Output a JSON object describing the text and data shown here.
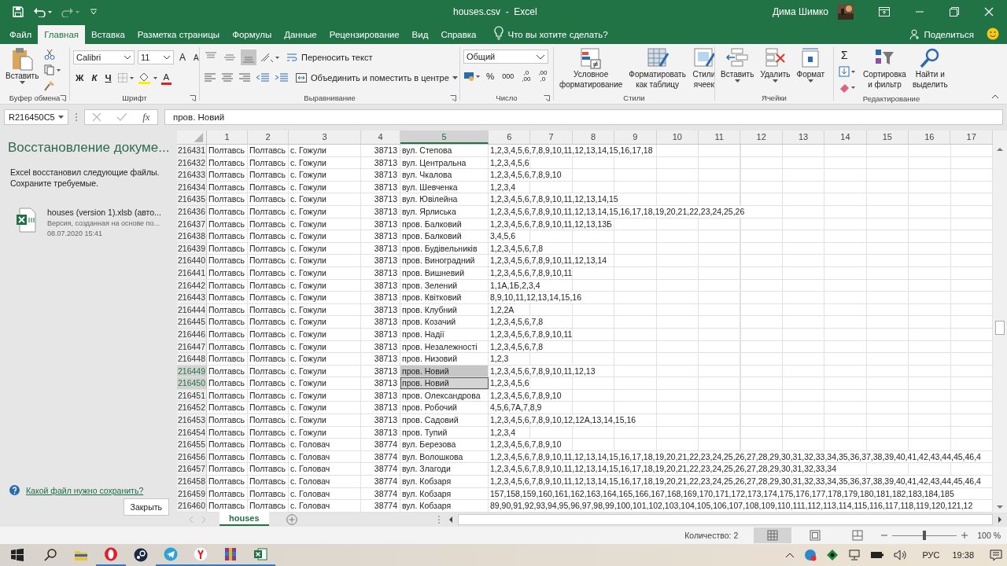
{
  "title_bar": {
    "title": "houses.csv  -  Excel",
    "user": "Дима Шимко"
  },
  "menu_tabs": [
    {
      "label": "Файл",
      "selected": false
    },
    {
      "label": "Главная",
      "selected": true
    },
    {
      "label": "Вставка",
      "selected": false
    },
    {
      "label": "Разметка страницы",
      "selected": false
    },
    {
      "label": "Формулы",
      "selected": false
    },
    {
      "label": "Данные",
      "selected": false
    },
    {
      "label": "Рецензирование",
      "selected": false
    },
    {
      "label": "Вид",
      "selected": false
    },
    {
      "label": "Справка",
      "selected": false
    }
  ],
  "tell_me": "Что вы хотите сделать?",
  "share": "Поделиться",
  "ribbon": {
    "clipboard": {
      "label": "Буфер обмена",
      "paste": "Вставить"
    },
    "font": {
      "label": "Шрифт",
      "name": "Calibri",
      "size": "11",
      "grow": "A",
      "shrink": "A",
      "bold": "Ж",
      "italic": "К",
      "underline": "Ч",
      "color_letter": "A"
    },
    "alignment": {
      "label": "Выравнивание",
      "vertical": [
        {
          "kind": "top",
          "selected": false
        },
        {
          "kind": "middle",
          "selected": false
        },
        {
          "kind": "bottom",
          "selected": true
        }
      ],
      "wrap": "Переносить текст",
      "merge": "Объединить и поместить в центре"
    },
    "number": {
      "label": "Число",
      "format": "Общий",
      "percent": "%",
      "thousands": "000",
      "decimals": [
        {
          "top": ",0",
          "bottom": ",00"
        },
        {
          "top": ",00",
          "bottom": ",0"
        }
      ]
    },
    "styles": {
      "label": "Стили",
      "buttons": [
        {
          "kind": "conditional",
          "lines": [
            "Условное",
            "форматирование"
          ]
        },
        {
          "kind": "table",
          "lines": [
            "Форматировать",
            "как таблицу"
          ]
        },
        {
          "kind": "cell",
          "lines": [
            "Стили",
            "ячеек"
          ]
        }
      ]
    },
    "cells": {
      "label": "Ячейки",
      "buttons": [
        {
          "kind": "insert",
          "label": "Вставить"
        },
        {
          "kind": "delete",
          "label": "Удалить"
        },
        {
          "kind": "format",
          "label": "Формат"
        }
      ]
    },
    "editing": {
      "label": "Редактирование",
      "sum": "Σ",
      "buttons": [
        {
          "kind": "sort",
          "lines": [
            "Сортировка",
            "и фильтр"
          ]
        },
        {
          "kind": "find",
          "lines": [
            "Найти и",
            "выделить"
          ]
        }
      ]
    }
  },
  "formula_bar": {
    "name_box": "R216450C5",
    "fx": "fx",
    "value": "пров. Новий"
  },
  "recovery": {
    "title": "Восстановление докуме...",
    "message": "Excel восстановил следующие файлы. Сохраните требуемые.",
    "file": {
      "name": "houses (version 1).xlsb  (авто...",
      "description": "Версия, созданная на основе по...",
      "date": "08.07.2020 15:41"
    },
    "help_link": "Какой файл нужно сохранить?",
    "close": "Закрыть"
  },
  "grid": {
    "columns": [
      {
        "label": "1",
        "selected": false
      },
      {
        "label": "2",
        "selected": false
      },
      {
        "label": "3",
        "selected": false
      },
      {
        "label": "4",
        "selected": false
      },
      {
        "label": "5",
        "selected": true
      },
      {
        "label": "6",
        "selected": false
      },
      {
        "label": "7",
        "selected": false
      },
      {
        "label": "8",
        "selected": false
      },
      {
        "label": "9",
        "selected": false
      },
      {
        "label": "10",
        "selected": false
      },
      {
        "label": "11",
        "selected": false
      },
      {
        "label": "12",
        "selected": false
      },
      {
        "label": "13",
        "selected": false
      },
      {
        "label": "14",
        "selected": false
      },
      {
        "label": "15",
        "selected": false
      },
      {
        "label": "16",
        "selected": false
      },
      {
        "label": "17",
        "selected": false
      }
    ],
    "rows": [
      {
        "number": "216431",
        "cells": [
          "Полтавсь",
          "Полтавсь",
          "с. Гожули",
          "38713",
          "вул. Степова",
          "1,2,3,4,5,6,7,8,9,10,11,12,13,14,15,16,17,18"
        ],
        "selected": false,
        "active": false
      },
      {
        "number": "216432",
        "cells": [
          "Полтавсь",
          "Полтавсь",
          "с. Гожули",
          "38713",
          "вул. Центральна",
          "1,2,3,4,5,6"
        ],
        "selected": false,
        "active": false
      },
      {
        "number": "216433",
        "cells": [
          "Полтавсь",
          "Полтавсь",
          "с. Гожули",
          "38713",
          "вул. Чкалова",
          "1,2,3,4,5,6,7,8,9,10"
        ],
        "selected": false,
        "active": false
      },
      {
        "number": "216434",
        "cells": [
          "Полтавсь",
          "Полтавсь",
          "с. Гожули",
          "38713",
          "вул. Шевченка",
          "1,2,3,4"
        ],
        "selected": false,
        "active": false
      },
      {
        "number": "216435",
        "cells": [
          "Полтавсь",
          "Полтавсь",
          "с. Гожули",
          "38713",
          "вул. Ювілейна",
          "1,2,3,4,5,6,7,8,9,10,11,12,13,14,15"
        ],
        "selected": false,
        "active": false
      },
      {
        "number": "216436",
        "cells": [
          "Полтавсь",
          "Полтавсь",
          "с. Гожули",
          "38713",
          "вул. Ярлиська",
          "1,2,3,4,5,6,7,8,9,10,11,12,13,14,15,16,17,18,19,20,21,22,23,24,25,26"
        ],
        "selected": false,
        "active": false
      },
      {
        "number": "216437",
        "cells": [
          "Полтавсь",
          "Полтавсь",
          "с. Гожули",
          "38713",
          "пров. Балковий",
          "1,2,3,4,5,6,7,8,9,10,11,12,13,13Б"
        ],
        "selected": false,
        "active": false
      },
      {
        "number": "216438",
        "cells": [
          "Полтавсь",
          "Полтавсь",
          "с. Гожули",
          "38713",
          "пров. Балковий",
          "3,4,5,6"
        ],
        "selected": false,
        "active": false
      },
      {
        "number": "216439",
        "cells": [
          "Полтавсь",
          "Полтавсь",
          "с. Гожули",
          "38713",
          "пров. Будівельників",
          "1,2,3,4,5,6,7,8"
        ],
        "selected": false,
        "active": false
      },
      {
        "number": "216440",
        "cells": [
          "Полтавсь",
          "Полтавсь",
          "с. Гожули",
          "38713",
          "пров. Виноградний",
          "1,2,3,4,5,6,7,8,9,10,11,12,13,14"
        ],
        "selected": false,
        "active": false
      },
      {
        "number": "216441",
        "cells": [
          "Полтавсь",
          "Полтавсь",
          "с. Гожули",
          "38713",
          "пров. Вишневий",
          "1,2,3,4,5,6,7,8,9,10,11"
        ],
        "selected": false,
        "active": false
      },
      {
        "number": "216442",
        "cells": [
          "Полтавсь",
          "Полтавсь",
          "с. Гожули",
          "38713",
          "пров. Зелений",
          "1,1А,1Б,2,3,4"
        ],
        "selected": false,
        "active": false
      },
      {
        "number": "216443",
        "cells": [
          "Полтавсь",
          "Полтавсь",
          "с. Гожули",
          "38713",
          "пров. Квітковий",
          "8,9,10,11,12,13,14,15,16"
        ],
        "selected": false,
        "active": false
      },
      {
        "number": "216444",
        "cells": [
          "Полтавсь",
          "Полтавсь",
          "с. Гожули",
          "38713",
          "пров. Клубний",
          "1,2,2А"
        ],
        "selected": false,
        "active": false
      },
      {
        "number": "216445",
        "cells": [
          "Полтавсь",
          "Полтавсь",
          "с. Гожули",
          "38713",
          "пров. Козачий",
          "1,2,3,4,5,6,7,8"
        ],
        "selected": false,
        "active": false
      },
      {
        "number": "216446",
        "cells": [
          "Полтавсь",
          "Полтавсь",
          "с. Гожули",
          "38713",
          "пров. Надії",
          "1,2,3,4,5,6,7,8,9,10,11"
        ],
        "selected": false,
        "active": false
      },
      {
        "number": "216447",
        "cells": [
          "Полтавсь",
          "Полтавсь",
          "с. Гожули",
          "38713",
          "пров. Незалежності",
          "1,2,3,4,5,6,7,8"
        ],
        "selected": false,
        "active": false
      },
      {
        "number": "216448",
        "cells": [
          "Полтавсь",
          "Полтавсь",
          "с. Гожули",
          "38713",
          "пров. Низовий",
          "1,2,3"
        ],
        "selected": false,
        "active": false
      },
      {
        "number": "216449",
        "cells": [
          "Полтавсь",
          "Полтавсь",
          "с. Гожули",
          "38713",
          "пров. Новий",
          "1,2,3,4,5,6,7,8,9,10,11,12,13"
        ],
        "selected": true,
        "active": false
      },
      {
        "number": "216450",
        "cells": [
          "Полтавсь",
          "Полтавсь",
          "с. Гожули",
          "38713",
          "пров. Новий",
          "1,2,3,4,5,6"
        ],
        "selected": true,
        "active": true
      },
      {
        "number": "216451",
        "cells": [
          "Полтавсь",
          "Полтавсь",
          "с. Гожули",
          "38713",
          "пров. Олександрова",
          "1,2,3,4,5,6,7,8,9,10"
        ],
        "selected": false,
        "active": false
      },
      {
        "number": "216452",
        "cells": [
          "Полтавсь",
          "Полтавсь",
          "с. Гожули",
          "38713",
          "пров. Робочий",
          "4,5,6,7А,7,8,9"
        ],
        "selected": false,
        "active": false
      },
      {
        "number": "216453",
        "cells": [
          "Полтавсь",
          "Полтавсь",
          "с. Гожули",
          "38713",
          "пров. Садовий",
          "1,2,3,4,5,6,7,8,9,10,12,12А,13,14,15,16"
        ],
        "selected": false,
        "active": false
      },
      {
        "number": "216454",
        "cells": [
          "Полтавсь",
          "Полтавсь",
          "с. Гожули",
          "38713",
          "пров. Тупий",
          "1,2,3,4"
        ],
        "selected": false,
        "active": false
      },
      {
        "number": "216455",
        "cells": [
          "Полтавсь",
          "Полтавсь",
          "с. Головач",
          "38774",
          "вул. Березова",
          "1,2,3,4,5,6,7,8,9,10"
        ],
        "selected": false,
        "active": false
      },
      {
        "number": "216456",
        "cells": [
          "Полтавсь",
          "Полтавсь",
          "с. Головач",
          "38774",
          "вул. Волошкова",
          "1,2,3,4,5,6,7,8,9,10,11,12,13,14,15,16,17,18,19,20,21,22,23,24,25,26,27,28,29,30,31,32,33,34,35,36,37,38,39,40,41,42,43,44,45,46,4"
        ],
        "selected": false,
        "active": false
      },
      {
        "number": "216457",
        "cells": [
          "Полтавсь",
          "Полтавсь",
          "с. Головач",
          "38774",
          "вул. Злагоди",
          "1,2,3,4,5,6,7,8,9,10,11,12,13,14,15,16,17,18,19,20,21,22,23,24,25,26,27,28,29,30,31,32,33,34"
        ],
        "selected": false,
        "active": false
      },
      {
        "number": "216458",
        "cells": [
          "Полтавсь",
          "Полтавсь",
          "с. Головач",
          "38774",
          "вул. Кобзаря",
          "1,2,3,4,5,6,7,8,9,10,11,12,13,14,15,16,17,18,19,20,21,22,23,24,25,26,27,28,29,30,31,32,33,34,35,36,37,38,39,40,41,42,43,44,45,46,4"
        ],
        "selected": false,
        "active": false
      },
      {
        "number": "216459",
        "cells": [
          "Полтавсь",
          "Полтавсь",
          "с. Головач",
          "38774",
          "вул. Кобзаря",
          "157,158,159,160,161,162,163,164,165,166,167,168,169,170,171,172,173,174,175,176,177,178,179,180,181,182,183,184,185"
        ],
        "selected": false,
        "active": false
      },
      {
        "number": "216460",
        "cells": [
          "Полтавсь",
          "Полтавсь",
          "с. Головач",
          "38774",
          "вул. Кобзаря",
          "89,90,91,92,93,94,95,96,97,98,99,100,101,102,103,104,105,106,107,108,109,110,111,112,113,114,115,116,117,118,119,120,121,12"
        ],
        "selected": false,
        "active": false
      }
    ]
  },
  "sheet_tabs": [
    {
      "label": "houses",
      "selected": true
    }
  ],
  "status_bar": {
    "count": "Количество: 2",
    "views": [
      {
        "kind": "normal",
        "selected": true
      },
      {
        "kind": "page_layout",
        "selected": false
      },
      {
        "kind": "page_break",
        "selected": false
      }
    ],
    "zoom": {
      "level": 0.5,
      "reading": "100 %"
    }
  },
  "taskbar": {
    "apps": [
      {
        "kind": "explorer",
        "running": false
      },
      {
        "kind": "opera",
        "running": true
      },
      {
        "kind": "steam",
        "running": false
      },
      {
        "kind": "telegram",
        "running": true
      },
      {
        "kind": "yandex",
        "running": true
      },
      {
        "kind": "winrar",
        "running": true
      },
      {
        "kind": "excel",
        "running": true
      }
    ],
    "language": "РУС",
    "time": "19:38"
  }
}
